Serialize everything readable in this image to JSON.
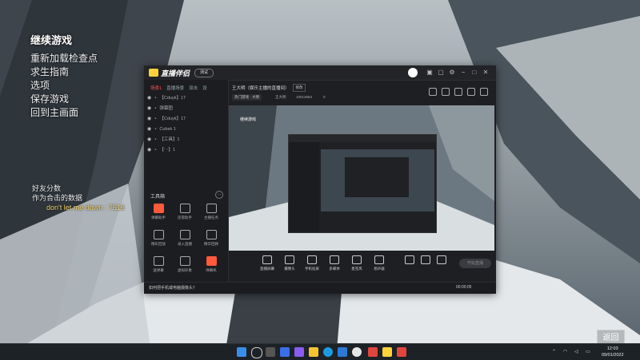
{
  "game_menu": {
    "title": "继续游戏",
    "items": [
      "重新加载检查点",
      "求生指南",
      "选项",
      "保存游戏",
      "回到主画面"
    ]
  },
  "friends": {
    "header": "好友分数",
    "subheader": "作为合击的数据",
    "player_line": "don't let me down : 7516"
  },
  "app": {
    "brand": "直播伴侣",
    "version_badge": "测试",
    "sidebar_tabs": [
      "场景1",
      "直播场景",
      "双击",
      "设"
    ],
    "layers": [
      "【Cduyk】17",
      "弹幕图",
      "【Cduyk】17",
      "Cubek 1",
      "【工具】1",
      "【⋯】1"
    ],
    "tools_title": "工具箱",
    "tools": [
      "弹幕助手",
      "房管助手",
      "主播任务",
      "精彩回放",
      "录入直播",
      "精华回顾",
      "送弹幕",
      "虚拟形象",
      "弹幕机"
    ],
    "room_title": "王大明（娱乐主播的直播间）",
    "room_btn": "修改",
    "category": "热门游戏 · 大明",
    "anchor_name": "王大明",
    "room_id": "10013663",
    "online": "0",
    "preview_text": "继续游戏",
    "controls": [
      "直播屏幕",
      "摄像头",
      "手机投屏",
      "多媒体",
      "麦克风",
      "扬声器"
    ],
    "start_label": "开始直播",
    "status_tip": "如何把手机或电脑摄像头？",
    "status_time": "00:00:05"
  },
  "back_label": "返回",
  "clock": {
    "time": "12:03",
    "date": "09/01/2022"
  },
  "colors": {
    "accent": "#ff5a3c",
    "brand": "#ffd23c"
  }
}
